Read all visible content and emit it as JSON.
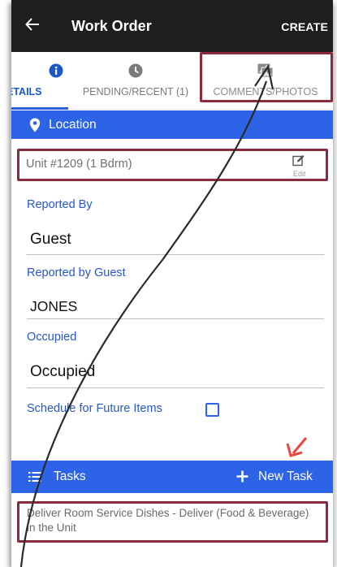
{
  "appbar": {
    "title": "Work Order",
    "create_label": "CREATE"
  },
  "tabs": [
    {
      "label": "ETAILS",
      "icon": "info-icon",
      "active": true
    },
    {
      "label": "PENDING/RECENT (1)",
      "icon": "clock-icon",
      "active": false
    },
    {
      "label": "COMMENTS/PHOTOS",
      "icon": "photos-icon",
      "active": false
    }
  ],
  "location": {
    "header": "Location",
    "unit": "Unit #1209 (1 Bdrm)",
    "edit_label": "Edit"
  },
  "fields": {
    "reported_by": {
      "label": "Reported By",
      "value": "Guest"
    },
    "reported_by_guest": {
      "label": "Reported by Guest",
      "value": "JONES"
    },
    "occupied": {
      "label": "Occupied",
      "value": "Occupied"
    },
    "schedule_future": {
      "label": "Schedule for Future Items",
      "checked": false
    }
  },
  "tasks": {
    "header": "Tasks",
    "new_task_label": "New Task",
    "items": [
      "Deliver Room Service Dishes - Deliver (Food & Beverage) in the Unit"
    ]
  },
  "colors": {
    "accent": "#2d63e6",
    "appbar": "#1e1e1e",
    "highlight": "#8b2a3d",
    "annotation_arrow": "#e8483d"
  }
}
